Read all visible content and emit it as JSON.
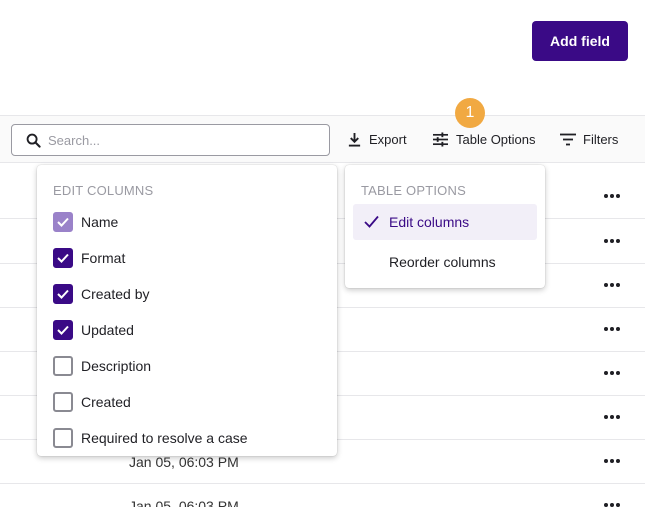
{
  "header": {
    "add_field_label": "Add field"
  },
  "toolbar": {
    "search_placeholder": "Search...",
    "export_label": "Export",
    "table_options_label": "Table Options",
    "filters_label": "Filters"
  },
  "step_badge": "1",
  "edit_columns": {
    "title": "EDIT COLUMNS",
    "items": [
      {
        "label": "Name",
        "checked": true,
        "disabled": true
      },
      {
        "label": "Format",
        "checked": true
      },
      {
        "label": "Created by",
        "checked": true
      },
      {
        "label": "Updated",
        "checked": true
      },
      {
        "label": "Description",
        "checked": false
      },
      {
        "label": "Created",
        "checked": false
      },
      {
        "label": "Required to resolve a case",
        "checked": false
      }
    ]
  },
  "table_options": {
    "title": "TABLE OPTIONS",
    "items": [
      {
        "label": "Edit columns",
        "selected": true
      },
      {
        "label": "Reorder columns",
        "selected": false
      }
    ]
  },
  "rows": [
    {
      "date": ""
    },
    {
      "date": ""
    },
    {
      "date": ""
    },
    {
      "date": ""
    },
    {
      "date": ""
    },
    {
      "date": ""
    },
    {
      "date": "Jan 05, 06:03 PM"
    },
    {
      "date": "Jan 05, 06:03 PM"
    }
  ],
  "colors": {
    "brand": "#3a0a86",
    "badge": "#f1a942",
    "selected_bg": "#f2eff8"
  },
  "icons": [
    "search-icon",
    "download-icon",
    "sliders-icon",
    "filter-icon",
    "check-icon",
    "more-horizontal-icon"
  ]
}
